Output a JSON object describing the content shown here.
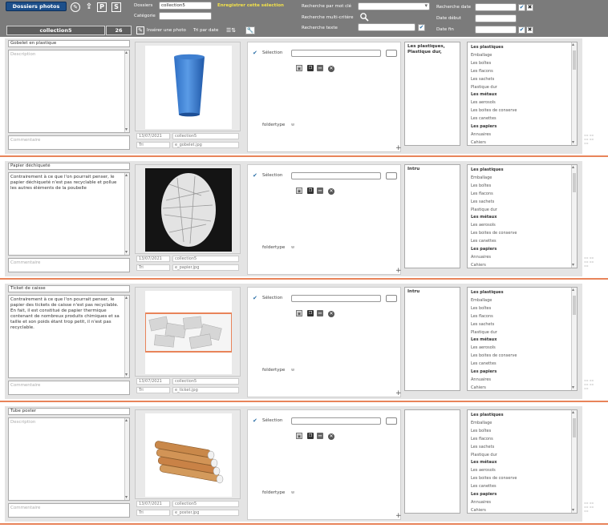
{
  "toolbar": {
    "main_button": "Dossiers photos",
    "icons": [
      {
        "name": "edit-icon",
        "glyph": "✎"
      },
      {
        "name": "upload-icon",
        "glyph": "⇪"
      },
      {
        "name": "p-icon",
        "glyph": "P"
      },
      {
        "name": "s-icon",
        "glyph": "S"
      }
    ],
    "dossiers_label": "Dossiers",
    "dossiers_value": "collection5",
    "categorie_label": "Catégorie",
    "categorie_value": "",
    "save_selection": "Enregistrer cette sélection",
    "search_keyword_label": "Recherche par mot clé",
    "search_multi_label": "Recherche multi-critère",
    "search_text_label": "Recherche texte",
    "search_date_label": "Recherche date",
    "date_start_label": "Date début",
    "date_end_label": "Date fin",
    "collection_box": "collection5",
    "count_box": "26",
    "insert_photo": "Insérer une photo",
    "sort_by_date": "Tri par date"
  },
  "categories_list": [
    {
      "label": "Les plastiques",
      "head": true
    },
    {
      "label": "Emballage",
      "head": false
    },
    {
      "label": "Les boîtes",
      "head": false
    },
    {
      "label": "Les flacons",
      "head": false
    },
    {
      "label": "Les sachets",
      "head": false
    },
    {
      "label": "Plastique dur",
      "head": false
    },
    {
      "label": "Les métaux",
      "head": true
    },
    {
      "label": "Les aerosols",
      "head": false
    },
    {
      "label": "Les boites de conserve",
      "head": false
    },
    {
      "label": "Les canettes",
      "head": false
    },
    {
      "label": "Les papiers",
      "head": true
    },
    {
      "label": "Annuaires",
      "head": false
    },
    {
      "label": "Cahiers",
      "head": false
    }
  ],
  "rows": [
    {
      "title": "Gobelet en plastique",
      "description": "Description",
      "description_is_placeholder": true,
      "comment": "Commentaire",
      "date": "13/07/2021",
      "collection": "collection5",
      "extra": "Tri",
      "file": "e_gobelet.jpg",
      "selection_label": "Sélection",
      "folder_label": "foldertype",
      "folder_value": "w",
      "category": "Les plastiques, Plastique dur,"
    },
    {
      "title": "Papier déchiqueté",
      "description": "Contrairement à ce que l'on pourrait penser, le papier déchiqueté n'est pas recyclable et pollue les autres éléments de la poubelle",
      "description_is_placeholder": false,
      "comment": "Commentaire",
      "date": "13/07/2021",
      "collection": "collection5",
      "extra": "Tri",
      "file": "e_papier.jpg",
      "selection_label": "Sélection",
      "folder_label": "foldertype",
      "folder_value": "w",
      "category": "Intru"
    },
    {
      "title": "Ticket de caisse",
      "description": "Contrairement à ce que l'on pourrait penser, le papier des tickets de caisse n'est pas recyclable. En fait, il est constitué de papier thermique contenant de nombreux produits chimiques et sa taille et son poids étant trop petit, il n'est pas recyclable.",
      "description_is_placeholder": false,
      "comment": "Commentaire",
      "date": "13/07/2021",
      "collection": "collection5",
      "extra": "Tri",
      "file": "e_ticket.jpg",
      "selection_label": "Sélection",
      "folder_label": "foldertype",
      "folder_value": "w",
      "category": "Intru"
    },
    {
      "title": "Tube poster",
      "description": "Description",
      "description_is_placeholder": true,
      "comment": "Commentaire",
      "date": "13/07/2021",
      "collection": "collection5",
      "extra": "Tri",
      "file": "e_poster.jpg",
      "selection_label": "Sélection",
      "folder_label": "foldertype",
      "folder_value": "w",
      "category": ""
    }
  ],
  "colors": {
    "toolbar_bg": "#7b7b7b",
    "main_button": "#1d4f8a",
    "accent_yellow": "#f2e14a",
    "row_separator": "#e8845a"
  }
}
